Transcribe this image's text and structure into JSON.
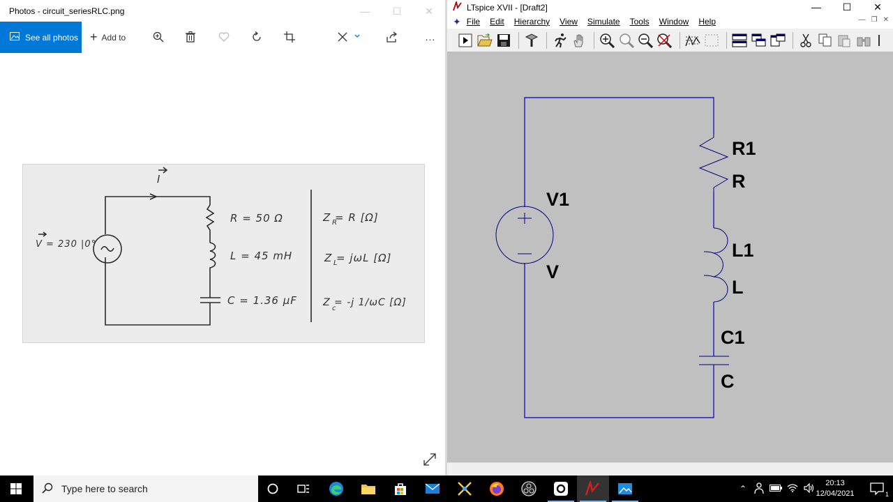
{
  "photos": {
    "title": "Photos - circuit_seriesRLC.png",
    "toolbar": {
      "see_all": "See all photos",
      "add_to": "Add to",
      "more": "..."
    },
    "image": {
      "current_label": "I",
      "source_label": "V = 230 |0°",
      "r_value": "R = 50 Ω",
      "l_value": "L = 45 mH",
      "c_value": "C = 1.36 µF",
      "zr": "Z  = R  [Ω]",
      "zr_sub": "R",
      "zl": "Z  = jωL  [Ω]",
      "zl_sub": "L",
      "zc": "Z  = -j  1/ωC  [Ω]",
      "zc_sub": "c"
    }
  },
  "ltspice": {
    "title": "LTspice XVII - [Draft2]",
    "menu": [
      "File",
      "Edit",
      "Hierarchy",
      "View",
      "Simulate",
      "Tools",
      "Window",
      "Help"
    ],
    "schematic": {
      "v_name": "V1",
      "v_value": "V",
      "r_name": "R1",
      "r_value": "R",
      "l_name": "L1",
      "l_value": "L",
      "c_name": "C1",
      "c_value": "C",
      "wire_color": "#0000c0"
    }
  },
  "taskbar": {
    "search_placeholder": "Type here to search",
    "time": "20:13",
    "date": "12/04/2021",
    "notification_count": "1"
  }
}
